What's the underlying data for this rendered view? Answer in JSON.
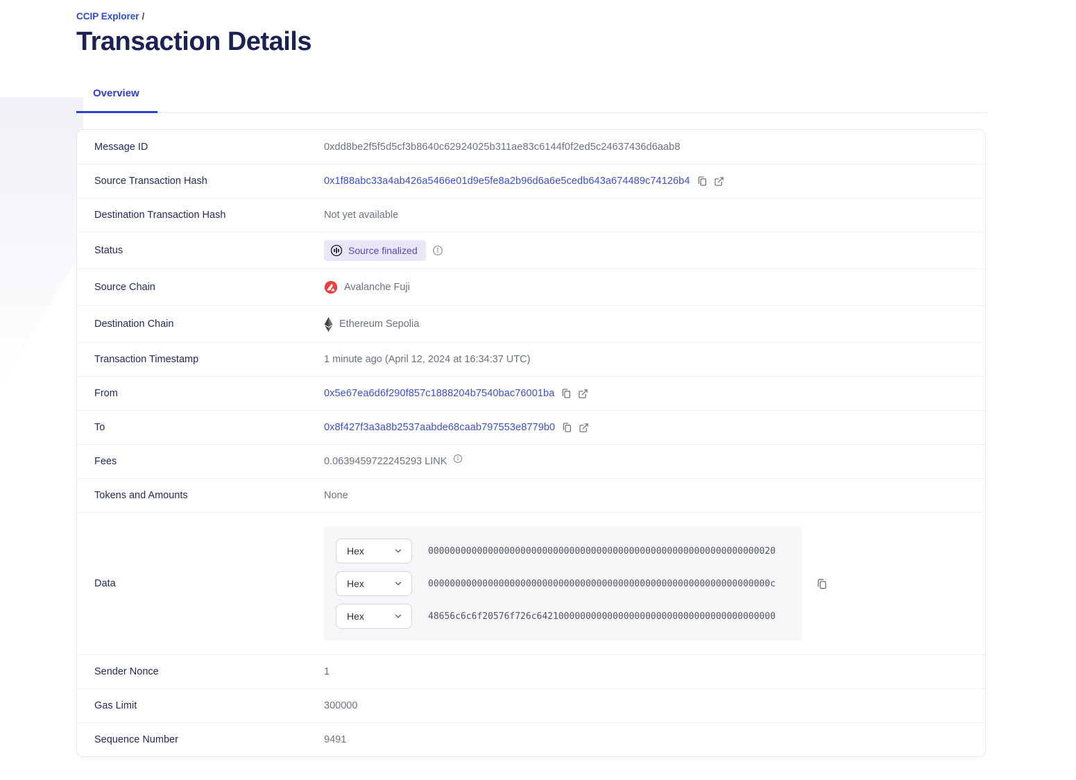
{
  "breadcrumb": {
    "link_label": "CCIP Explorer",
    "separator": "/"
  },
  "page_title": "Transaction Details",
  "tabs": {
    "overview": "Overview"
  },
  "fields": {
    "message_id": {
      "label": "Message ID",
      "value": "0xdd8be2f5f5d5cf3b8640c62924025b311ae83c6144f0f2ed5c24637436d6aab8"
    },
    "source_tx_hash": {
      "label": "Source Transaction Hash",
      "value": "0x1f88abc33a4ab426a5466e01d9e5fe8a2b96d6a6e5cedb643a674489c74126b4"
    },
    "dest_tx_hash": {
      "label": "Destination Transaction Hash",
      "value": "Not yet available"
    },
    "status": {
      "label": "Status",
      "badge": "Source finalized"
    },
    "source_chain": {
      "label": "Source Chain",
      "value": "Avalanche Fuji"
    },
    "dest_chain": {
      "label": "Destination Chain",
      "value": "Ethereum Sepolia"
    },
    "timestamp": {
      "label": "Transaction Timestamp",
      "value": "1 minute ago (April 12, 2024 at 16:34:37 UTC)"
    },
    "from": {
      "label": "From",
      "value": "0x5e67ea6d6f290f857c1888204b7540bac76001ba"
    },
    "to": {
      "label": "To",
      "value": "0x8f427f3a3a8b2537aabde68caab797553e8779b0"
    },
    "fees": {
      "label": "Fees",
      "value": "0.0639459722245293 LINK"
    },
    "tokens_and_amounts": {
      "label": "Tokens and Amounts",
      "value": "None"
    },
    "data": {
      "label": "Data",
      "encoding_selector": "Hex",
      "lines": [
        "0000000000000000000000000000000000000000000000000000000000000020",
        "000000000000000000000000000000000000000000000000000000000000000c",
        "48656c6c6f20576f726c64210000000000000000000000000000000000000000"
      ]
    },
    "sender_nonce": {
      "label": "Sender Nonce",
      "value": "1"
    },
    "gas_limit": {
      "label": "Gas Limit",
      "value": "300000"
    },
    "sequence_number": {
      "label": "Sequence Number",
      "value": "9491"
    }
  },
  "icons": {
    "copy": "copy-icon",
    "external_link": "external-link-icon",
    "info": "info-icon",
    "status_progress": "progress-circle-icon",
    "avalanche": "avalanche-logo-icon",
    "ethereum": "ethereum-logo-icon",
    "chevron_down": "chevron-down-icon"
  },
  "colors": {
    "link_blue": "#2c49d8",
    "hash_link_blue": "#3a4fd2",
    "title_navy": "#1b2152",
    "label_navy": "#232a5c",
    "value_gray": "#6b7280",
    "tab_blue": "#2b3fd0",
    "badge_bg": "#e9e6f8",
    "badge_text": "#5649bc",
    "avalanche_red": "#e84142",
    "data_box_bg": "#f6f6f8",
    "table_border": "#e7e9ee"
  }
}
